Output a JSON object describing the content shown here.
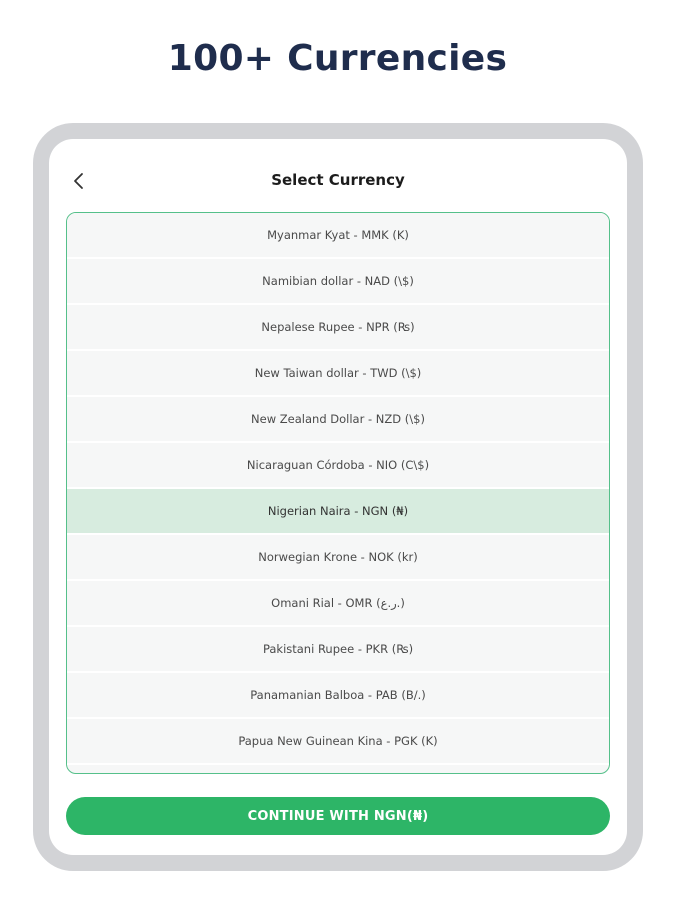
{
  "headline": "100+ Currencies",
  "screen": {
    "title": "Select Currency",
    "back_icon": "chevron-left-icon",
    "currencies": [
      {
        "label": "Myanmar Kyat - MMK (K)",
        "selected": false
      },
      {
        "label": "Namibian dollar - NAD (\\$)",
        "selected": false
      },
      {
        "label": "Nepalese Rupee - NPR (₨)",
        "selected": false
      },
      {
        "label": "New Taiwan dollar - TWD (\\$)",
        "selected": false
      },
      {
        "label": "New Zealand Dollar - NZD (\\$)",
        "selected": false
      },
      {
        "label": "Nicaraguan Córdoba - NIO (C\\$)",
        "selected": false
      },
      {
        "label": "Nigerian Naira - NGN (₦)",
        "selected": true
      },
      {
        "label": "Norwegian Krone - NOK (kr)",
        "selected": false
      },
      {
        "label": "Omani Rial - OMR (ر.ع.)",
        "selected": false
      },
      {
        "label": "Pakistani Rupee - PKR (₨)",
        "selected": false
      },
      {
        "label": "Panamanian Balboa - PAB (B/.)",
        "selected": false
      },
      {
        "label": "Papua New Guinean Kina - PGK (K)",
        "selected": false
      }
    ],
    "continue_label": "CONTINUE WITH NGN(₦)"
  },
  "colors": {
    "headline": "#1f2d4d",
    "accent_green": "#2db567",
    "list_border": "#55c08a",
    "selected_row": "#d7ecdf",
    "tablet_frame": "#d2d3d6"
  }
}
